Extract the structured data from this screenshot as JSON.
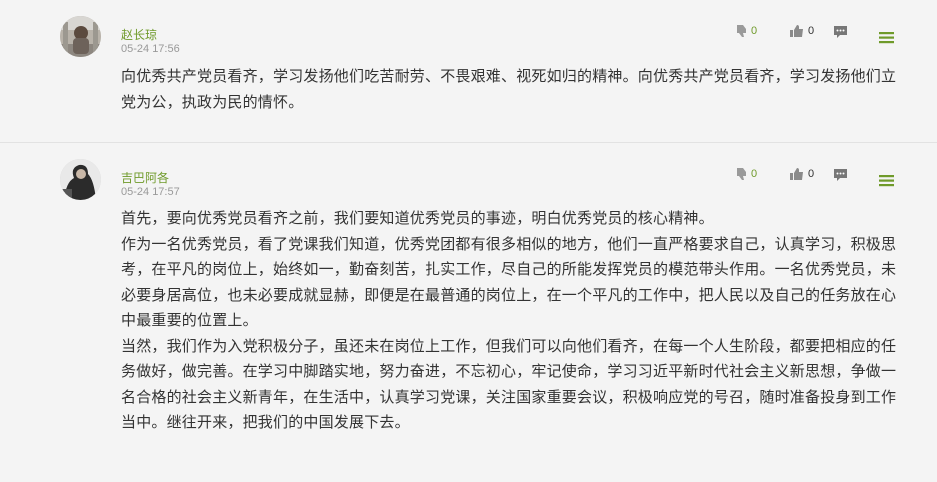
{
  "comments": [
    {
      "author": "赵长琼",
      "time": "05-24 17:56",
      "paragraphs": [
        "向优秀共产党员看齐，学习发扬他们吃苦耐劳、不畏艰难、视死如归的精神。向优秀共产党员看齐，学习发扬他们立党为公，执政为民的情怀。"
      ],
      "dislike_count": "0",
      "like_count": "0",
      "icons": {
        "dislike": "thumbs-down-icon",
        "like": "thumbs-up-icon",
        "reply": "comment-icon",
        "menu": "menu-icon"
      }
    },
    {
      "author": "吉巴阿各",
      "time": "05-24 17:57",
      "paragraphs": [
        "首先，要向优秀党员看齐之前，我们要知道优秀党员的事迹，明白优秀党员的核心精神。",
        "作为一名优秀党员，看了党课我们知道，优秀党团都有很多相似的地方，他们一直严格要求自己，认真学习，积极思考，在平凡的岗位上，始终如一，勤奋刻苦，扎实工作，尽自己的所能发挥党员的模范带头作用。一名优秀党员，未必要身居高位，也未必要成就显赫，即便是在最普通的岗位上，在一个平凡的工作中，把人民以及自己的任务放在心中最重要的位置上。",
        "当然，我们作为入党积极分子，虽还未在岗位上工作，但我们可以向他们看齐，在每一个人生阶段，都要把相应的任务做好，做完善。在学习中脚踏实地，努力奋进，不忘初心，牢记使命，学习习近平新时代社会主义新思想，争做一名合格的社会主义新青年，在生活中，认真学习党课，关注国家重要会议，积极响应党的号召，随时准备投身到工作当中。继往开来，把我们的中国发展下去。"
      ],
      "dislike_count": "0",
      "like_count": "0",
      "icons": {
        "dislike": "thumbs-down-icon",
        "like": "thumbs-up-icon",
        "reply": "comment-icon",
        "menu": "menu-icon"
      }
    }
  ],
  "colors": {
    "author": "#6f9a2a",
    "accent_green": "#6f9a2a",
    "text": "#333333",
    "meta": "#999999",
    "background": "#f4f4f4"
  }
}
